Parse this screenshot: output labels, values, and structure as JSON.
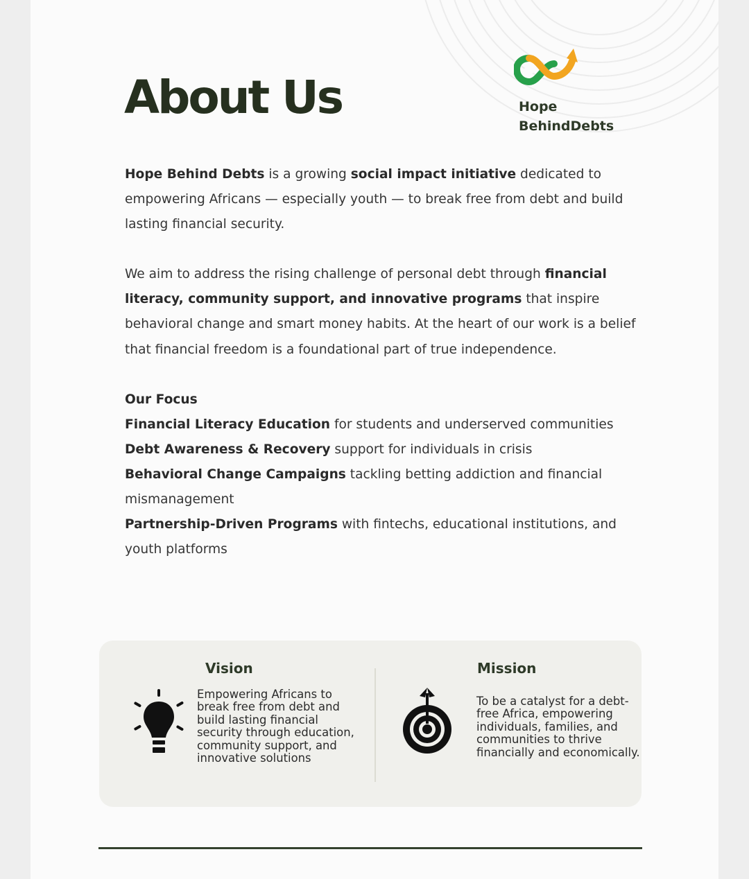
{
  "page": {
    "title": "About Us",
    "brand": {
      "line1": "Hope",
      "line2": "BehindDebts",
      "logo_icon": "infinity-arrow-icon"
    },
    "colors": {
      "brand_green": "#27a04a",
      "brand_orange": "#f2a520",
      "heading_dark": "#26301f"
    }
  },
  "intro": {
    "p1_strong1": "Hope Behind Debts",
    "p1_text1": " is a growing ",
    "p1_strong2": "social impact initiative",
    "p1_text2": " dedicated to empowering Africans — especially youth — to break free from debt and build lasting financial security.",
    "p2_text1": "We aim to address the rising challenge of personal debt through ",
    "p2_strong": "financial literacy, community support, and innovative programs",
    "p2_text2": " that inspire behavioral change and smart money habits. At the heart of our work is a belief that financial freedom is a foundational part of true independence."
  },
  "focus": {
    "heading": "Our Focus",
    "items": [
      {
        "strong": "Financial Literacy Education",
        "text": " for students and underserved communities"
      },
      {
        "strong": "Debt Awareness & Recovery",
        "text": " support for individuals in crisis"
      },
      {
        "strong": "Behavioral Change Campaigns",
        "text": " tackling betting addiction and financial mismanagement"
      },
      {
        "strong": "Partnership-Driven Programs",
        "text": " with fintechs, educational institutions, and youth platforms"
      }
    ]
  },
  "vision": {
    "heading": "Vision",
    "icon": "lightbulb-icon",
    "text": "Empowering Africans to break free from debt and build lasting financial security through education, community support, and innovative solutions"
  },
  "mission": {
    "heading": "Mission",
    "icon": "target-icon",
    "text": "To be a catalyst for a debt-free Africa, empowering individuals, families, and communities to thrive financially and economically."
  }
}
